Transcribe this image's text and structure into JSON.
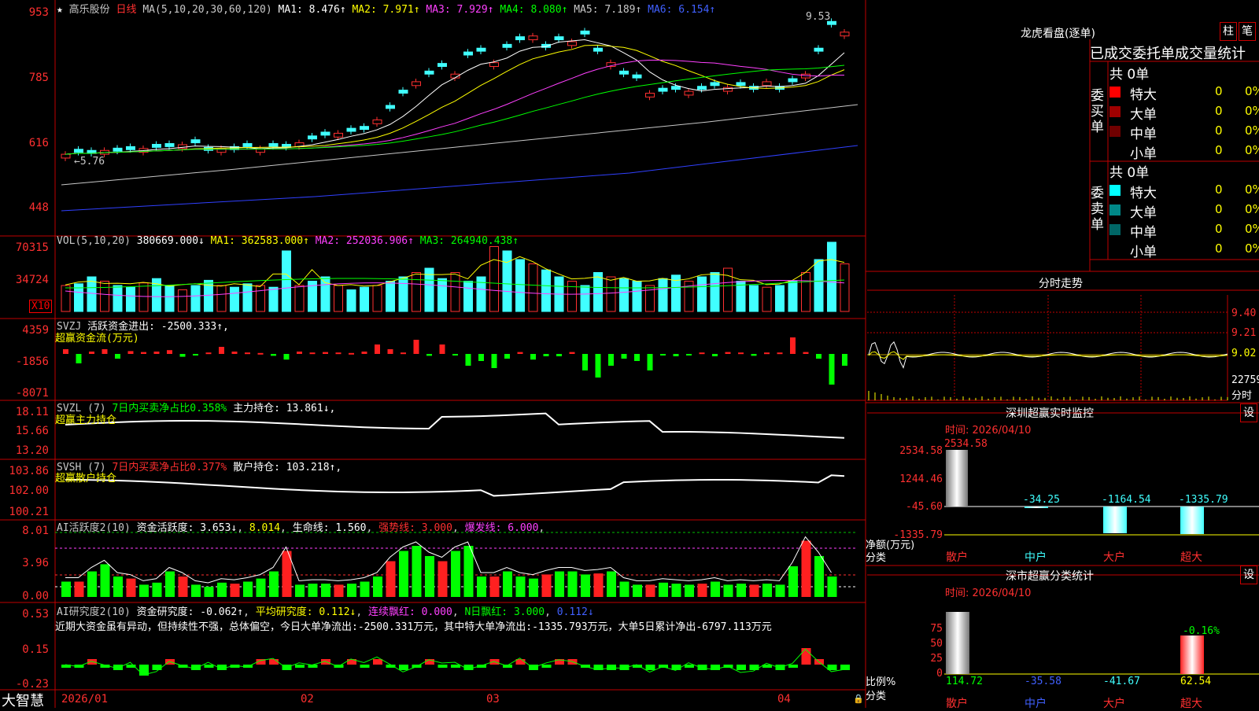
{
  "stock": {
    "name": "高乐股份",
    "period": "日线",
    "star": "★"
  },
  "ma": {
    "title": "MA(5,10,20,30,60,120)",
    "ma1": "MA1: 8.476↑",
    "ma2": "MA2: 7.971↑",
    "ma3": "MA3: 7.929↑",
    "ma4": "MA4: 8.080↑",
    "ma5": "MA5: 7.189↑",
    "ma6": "MA6: 6.154↑"
  },
  "price_axis": [
    "953",
    "785",
    "616",
    "448"
  ],
  "price_marks": {
    "high": "9.53",
    "low": "←5.76"
  },
  "vol": {
    "title": "VOL(5,10,20)",
    "val": "380669.000↓",
    "ma1": "MA1: 362583.000↑",
    "ma2": "MA2: 252036.906↑",
    "ma3": "MA3: 264940.438↑",
    "axis": [
      "70315",
      "34724"
    ],
    "unit": "X10"
  },
  "svzj": {
    "title": "SVZJ",
    "text": "活跃资金进出: -2500.333↑,",
    "sub": "超赢资金流(万元)",
    "axis": [
      "4359",
      "-1856",
      "-8071"
    ]
  },
  "svzl": {
    "title": "SVZL (7)",
    "pct": "7日内买卖净占比0.358%",
    "hold": "主力持仓: 13.861↓,",
    "sub": "超赢主力持仓",
    "axis": [
      "18.11",
      "15.66",
      "13.20"
    ]
  },
  "svsh": {
    "title": "SVSH (7)",
    "pct": "7日内买卖净占比0.377%",
    "hold": "散户持仓: 103.218↑,",
    "sub": "超赢散户持仓",
    "axis": [
      "103.86",
      "102.00",
      "100.21"
    ]
  },
  "ai1": {
    "title": "AI活跃度2(10)",
    "v1": "资金活跃度: 3.653↓",
    "v2": "8.014",
    "v3": "生命线: 1.560",
    "v4": "强势线: 3.000",
    "v5": "爆发线: 6.000",
    "axis": [
      "8.01",
      "3.96",
      "0.00"
    ]
  },
  "ai2": {
    "title": "AI研究度2(10)",
    "v1": "资金研究度: -0.062↑",
    "v2": "平均研究度: 0.112↓",
    "v3": "连续飘红: 0.000",
    "v4": "N日飘红: 3.000",
    "v5": "0.112↓",
    "note": "近期大资金虽有异动，但持续性不强，总体偏空，今日大单净流出:-2500.331万元，其中特大单净流出:-1335.793万元，大单5日累计净出-6797.113万元",
    "axis": [
      "0.53",
      "0.15",
      "-0.23"
    ]
  },
  "dates": [
    "2026/01",
    "02",
    "03",
    "04"
  ],
  "brand": "大智慧",
  "dragon": {
    "title": "龙虎看盘(逐单)",
    "btn1": "柱",
    "btn2": "笔",
    "header": "已成交委托单成交量统计",
    "buy": {
      "label": "委买单",
      "total": "共 0单",
      "rows": [
        {
          "name": "特大",
          "v": "0",
          "p": "0%",
          "color": "#ff0000"
        },
        {
          "name": "大单",
          "v": "0",
          "p": "0%",
          "color": "#a00000"
        },
        {
          "name": "中单",
          "v": "0",
          "p": "0%",
          "color": "#700000"
        },
        {
          "name": "小单",
          "v": "0",
          "p": "0%",
          "color": "#000000"
        }
      ]
    },
    "sell": {
      "label": "委卖单",
      "total": "共 0单",
      "rows": [
        {
          "name": "特大",
          "v": "0",
          "p": "0%",
          "color": "#00ffff"
        },
        {
          "name": "大单",
          "v": "0",
          "p": "0%",
          "color": "#008888"
        },
        {
          "name": "中单",
          "v": "0",
          "p": "0%",
          "color": "#006666"
        },
        {
          "name": "小单",
          "v": "0",
          "p": "0%",
          "color": "#000000"
        }
      ]
    }
  },
  "intraday": {
    "title": "分时走势",
    "axis": [
      "9.40",
      "9.21",
      "9.02"
    ],
    "vol": "22759",
    "unit": "分时"
  },
  "monitor": {
    "title": "深圳超赢实时监控",
    "btn": "设",
    "time": "时间: 2026/04/10",
    "axis": [
      "2534.58",
      "1244.46",
      "-45.60",
      "-1335.79"
    ],
    "values": [
      "2534.58",
      "-34.25",
      "-1164.54",
      "-1335.79"
    ],
    "cats": [
      "散户",
      "中户",
      "大户",
      "超大"
    ],
    "ylabel": "净额(万元)",
    "xlabel": "分类"
  },
  "stat": {
    "title": "深市超赢分类统计",
    "btn": "设",
    "time": "时间: 2026/04/10",
    "axis": [
      "75",
      "50",
      "25",
      "0"
    ],
    "values": [
      "114.72",
      "-35.58",
      "-41.67",
      "62.54"
    ],
    "top": "-0.16%",
    "cats": [
      "散户",
      "中户",
      "大户",
      "超大"
    ],
    "ylabel": "比例%",
    "xlabel": "分类"
  }
}
